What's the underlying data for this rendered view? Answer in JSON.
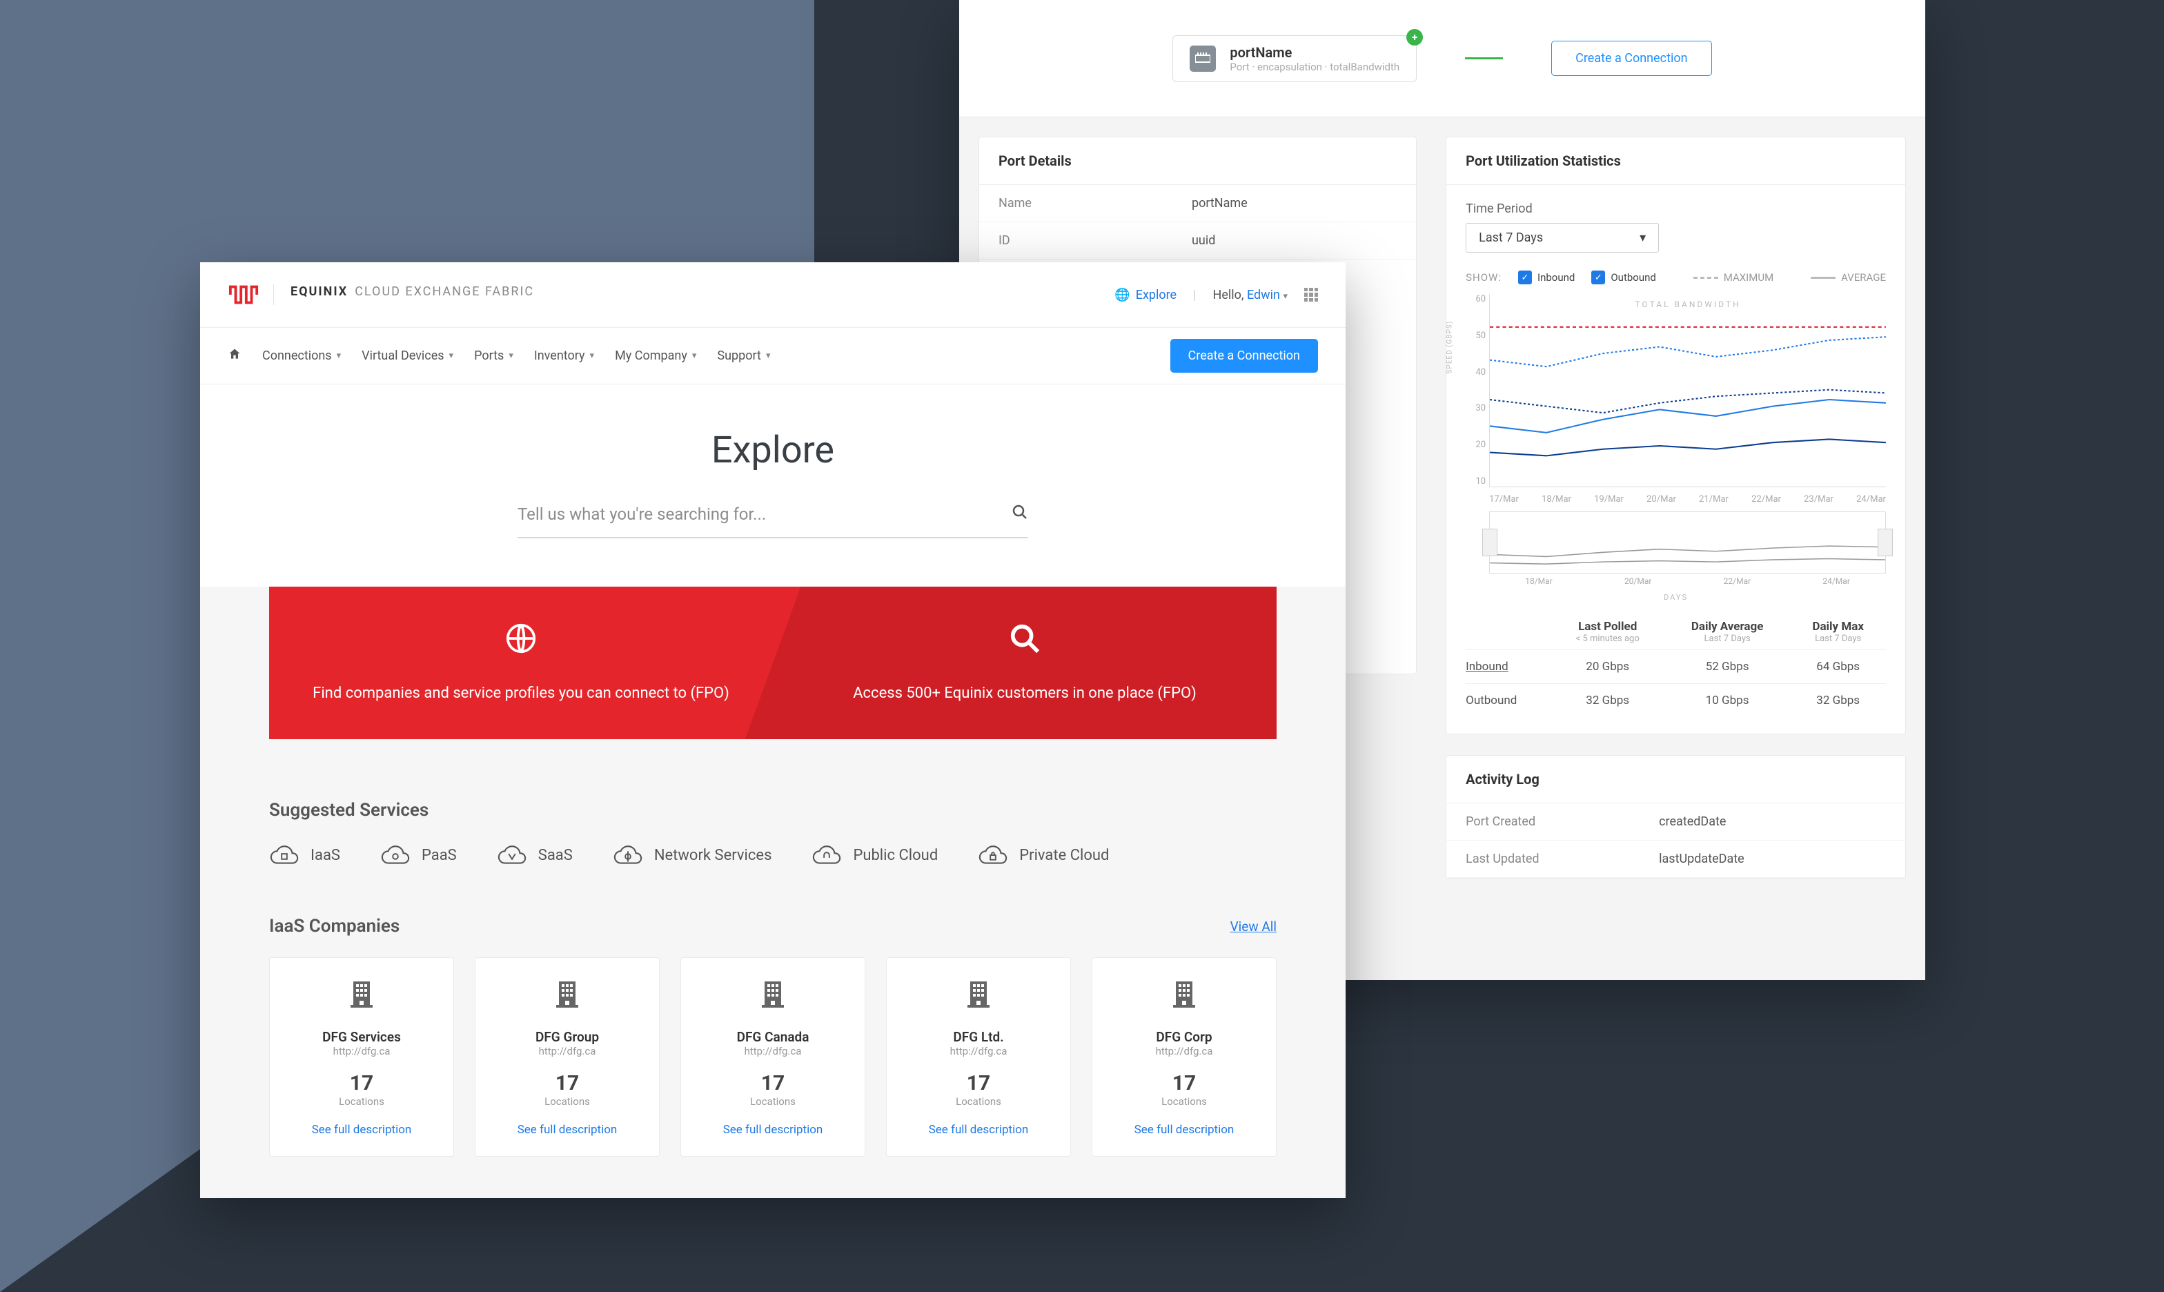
{
  "port_window": {
    "pill": {
      "name": "portName",
      "sub": "Port · encapsulation · totalBandwidth",
      "badge": "+"
    },
    "create_connection": "Create a Connection",
    "details": {
      "title": "Port Details",
      "rows": [
        {
          "k": "Name",
          "v": "portName"
        },
        {
          "k": "ID",
          "v": "uuid"
        }
      ]
    },
    "stats": {
      "title": "Port Utilization Statistics",
      "time_period_label": "Time Period",
      "time_period_value": "Last 7 Days",
      "show_label": "SHOW:",
      "inbound_label": "Inbound",
      "outbound_label": "Outbound",
      "maximum_label": "MAXIMUM",
      "average_label": "AVERAGE",
      "speed_axis": "SPEED (GBPS)",
      "total_bandwidth": "TOTAL BANDWIDTH",
      "y_ticks": [
        "60",
        "50",
        "40",
        "30",
        "20",
        "10"
      ],
      "x_ticks": [
        "17/Mar",
        "18/Mar",
        "19/Mar",
        "20/Mar",
        "21/Mar",
        "22/Mar",
        "23/Mar",
        "24/Mar"
      ],
      "mini_x": [
        "18/Mar",
        "20/Mar",
        "22/Mar",
        "24/Mar"
      ],
      "days_label": "DAYS",
      "table": {
        "headers": [
          {
            "t": "Last Polled",
            "s": "< 5 minutes ago"
          },
          {
            "t": "Daily Average",
            "s": "Last 7 Days"
          },
          {
            "t": "Daily Max",
            "s": "Last 7 Days"
          }
        ],
        "rows": [
          {
            "label": "Inbound",
            "link": true,
            "vals": [
              "20 Gbps",
              "52 Gbps",
              "64 Gbps"
            ]
          },
          {
            "label": "Outbound",
            "link": false,
            "vals": [
              "32 Gbps",
              "10 Gbps",
              "32 Gbps"
            ]
          }
        ]
      }
    },
    "activity": {
      "title": "Activity Log",
      "rows": [
        {
          "k": "Port Created",
          "v": "createdDate"
        },
        {
          "k": "Last Updated",
          "v": "lastUpdateDate"
        }
      ]
    }
  },
  "explore_window": {
    "brand_primary": "EQUINIX",
    "brand_secondary": "CLOUD EXCHANGE FABRIC",
    "explore_link": "Explore",
    "hello_prefix": "Hello, ",
    "hello_name": "Edwin",
    "nav": [
      "Connections",
      "Virtual Devices",
      "Ports",
      "Inventory",
      "My Company",
      "Support"
    ],
    "create_connection": "Create a Connection",
    "hero_title": "Explore",
    "search_placeholder": "Tell us what you're searching for...",
    "red_left": "Find companies and service profiles you can connect to (FPO)",
    "red_right": "Access 500+ Equinix customers in one place (FPO)",
    "suggested_title": "Suggested Services",
    "suggested": [
      "IaaS",
      "PaaS",
      "SaaS",
      "Network Services",
      "Public Cloud",
      "Private Cloud"
    ],
    "companies_title": "IaaS Companies",
    "view_all": "View All",
    "companies": [
      {
        "name": "DFG Services",
        "url": "http://dfg.ca",
        "count": "17",
        "loc": "Locations",
        "link": "See full description"
      },
      {
        "name": "DFG Group",
        "url": "http://dfg.ca",
        "count": "17",
        "loc": "Locations",
        "link": "See full description"
      },
      {
        "name": "DFG Canada",
        "url": "http://dfg.ca",
        "count": "17",
        "loc": "Locations",
        "link": "See full description"
      },
      {
        "name": "DFG Ltd.",
        "url": "http://dfg.ca",
        "count": "17",
        "loc": "Locations",
        "link": "See full description"
      },
      {
        "name": "DFG Corp",
        "url": "http://dfg.ca",
        "count": "17",
        "loc": "Locations",
        "link": "See full description"
      }
    ]
  },
  "chart_data": {
    "type": "line",
    "title": "Port Utilization Statistics",
    "xlabel": "DAYS",
    "ylabel": "SPEED (GBPS)",
    "ylim": [
      0,
      60
    ],
    "x": [
      "17/Mar",
      "18/Mar",
      "19/Mar",
      "20/Mar",
      "21/Mar",
      "22/Mar",
      "23/Mar",
      "24/Mar"
    ],
    "total_bandwidth": 50,
    "series": [
      {
        "name": "Inbound (maximum)",
        "style": "dashed",
        "color": "#1e7ae6",
        "values": [
          40,
          38,
          42,
          44,
          41,
          43,
          46,
          47
        ]
      },
      {
        "name": "Inbound (average)",
        "style": "solid",
        "color": "#1e7ae6",
        "values": [
          20,
          18,
          22,
          25,
          23,
          26,
          28,
          27
        ]
      },
      {
        "name": "Outbound (maximum)",
        "style": "dashed",
        "color": "#0b3d91",
        "values": [
          28,
          26,
          24,
          27,
          29,
          30,
          31,
          30
        ]
      },
      {
        "name": "Outbound (average)",
        "style": "solid",
        "color": "#0b3d91",
        "values": [
          12,
          11,
          13,
          14,
          13,
          15,
          16,
          15
        ]
      }
    ]
  }
}
